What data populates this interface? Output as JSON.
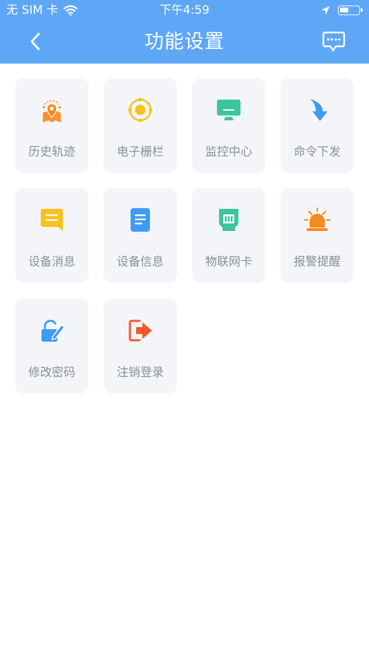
{
  "status_bar": {
    "carrier": "无 SIM 卡",
    "time": "下午4:59"
  },
  "header": {
    "title": "功能设置",
    "back_icon": "chevron-left-icon",
    "message_icon": "message-icon"
  },
  "colors": {
    "header_bg": "#5EA7F7",
    "tile_bg": "#F4F5F8",
    "label": "#8A8F98"
  },
  "menu": [
    {
      "label": "历史轨迹",
      "icon": "map-pin-icon",
      "color": "#F58A1F"
    },
    {
      "label": "电子栅栏",
      "icon": "geofence-icon",
      "color": "#F7C21A"
    },
    {
      "label": "监控中心",
      "icon": "monitor-icon",
      "color": "#3CC59B"
    },
    {
      "label": "命令下发",
      "icon": "arrow-down-icon",
      "color": "#3D9BF2"
    },
    {
      "label": "设备消息",
      "icon": "message-bubble-icon",
      "color": "#F7C21A"
    },
    {
      "label": "设备信息",
      "icon": "document-icon",
      "color": "#3D9BF2"
    },
    {
      "label": "物联网卡",
      "icon": "sim-card-icon",
      "color": "#3CC59B"
    },
    {
      "label": "报警提醒",
      "icon": "alarm-light-icon",
      "color": "#F58A1F"
    },
    {
      "label": "修改密码",
      "icon": "lock-edit-icon",
      "color": "#3D9BF2"
    },
    {
      "label": "注销登录",
      "icon": "logout-icon",
      "color": "#F25A2C"
    }
  ]
}
